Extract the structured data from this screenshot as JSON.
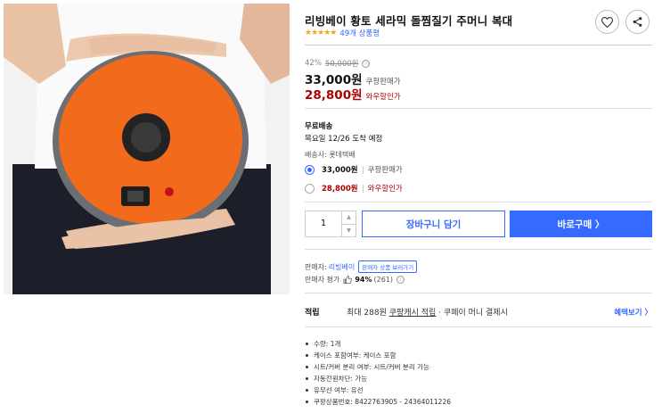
{
  "product": {
    "title": "리빙베이 황토 세라믹 돌찜질기 주머니 복대",
    "stars": "★★★★★",
    "review_count": "49개 상품평",
    "rating_value": 5
  },
  "price": {
    "discount_rate": "42%",
    "original_price": "50,000원",
    "info_icon": "ⓘ",
    "coupang_price": "33,000원",
    "coupang_label": "쿠팡판매가",
    "wow_price": "28,800원",
    "wow_label": "와우할인가"
  },
  "shipping": {
    "title": "무료배송",
    "arrival": "목요일 12/26 도착 예정",
    "carrier": "배송사: 롯데택배"
  },
  "options": [
    {
      "price": "33,000원",
      "label": "쿠팡판매가",
      "selected": true
    },
    {
      "price": "28,800원",
      "label": "와우할인가",
      "selected": false
    }
  ],
  "purchase": {
    "quantity": "1",
    "up_icon": "▲",
    "down_icon": "▼",
    "cart_label": "장바구니 담기",
    "buy_label": "바로구매 〉"
  },
  "seller": {
    "prefix": "판매자:",
    "name": "리빙베이",
    "tag": "판매자 상품 보러가기",
    "rating_prefix": "판매자 평가",
    "rating_pct": "94%",
    "rating_count": "(261)"
  },
  "points": {
    "label": "적립",
    "text_before": "최대 288원",
    "text_link": "쿠팡캐시 적립",
    "text_after": "· 쿠페이 머니 결제시",
    "more": "혜택보기 〉"
  },
  "specs": [
    "수량: 1개",
    "케이스 포함여부: 케이스 포함",
    "시트/커버 분리 여부: 시트/커버 분리 가능",
    "자동전원차단: 가능",
    "유무선 여부: 유선",
    "쿠팡상품번호: 8422763905 - 24364011226"
  ],
  "colors": {
    "accent": "#346aff",
    "sale": "#ae0000",
    "star": "#f8a41c",
    "device": "#f26a1b"
  },
  "icons": {
    "heart": "heart-icon",
    "share": "share-icon",
    "thumb": "thumbs-up-icon"
  }
}
